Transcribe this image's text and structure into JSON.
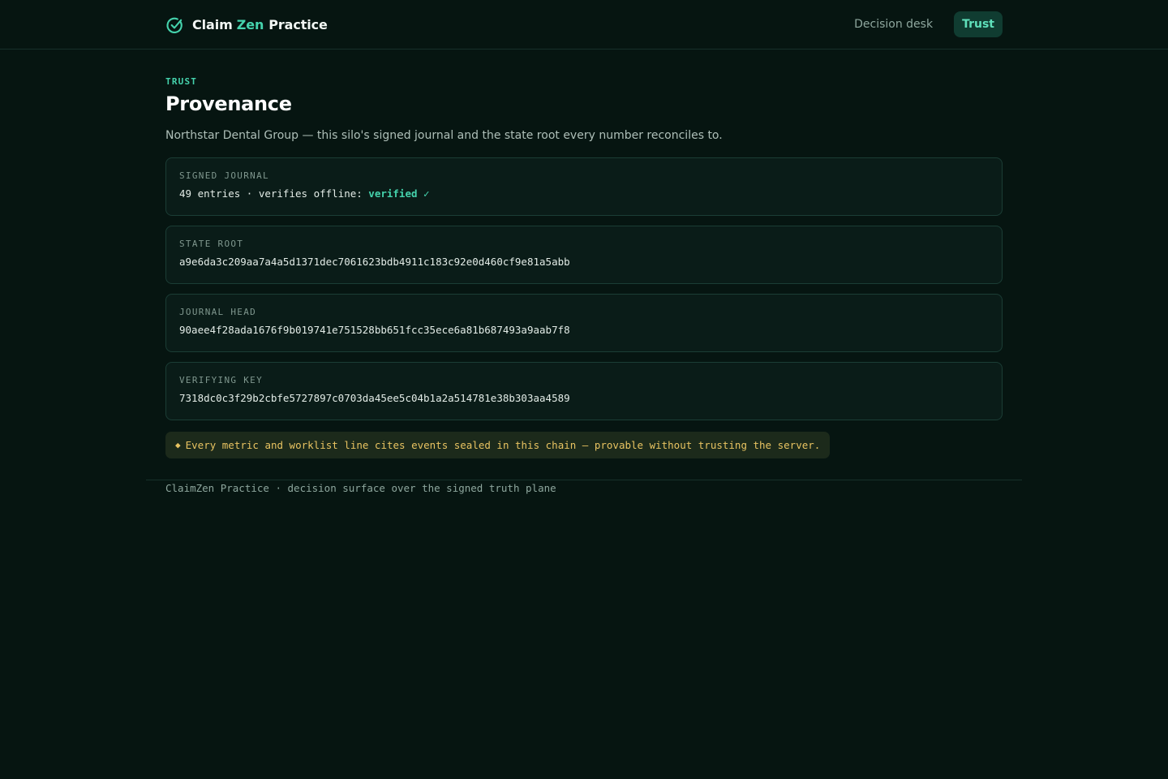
{
  "header": {
    "brand": {
      "part1": "Claim",
      "part2": "Zen",
      "part3": "Practice",
      "icon": "check-circle-icon"
    },
    "nav": [
      {
        "label": "Decision desk",
        "active": false
      },
      {
        "label": "Trust",
        "active": true
      }
    ]
  },
  "page": {
    "eyebrow": "TRUST",
    "title": "Provenance",
    "subtitle": "Northstar Dental Group — this silo's signed journal and the state root every number reconciles to."
  },
  "cards": {
    "signed_journal": {
      "label": "SIGNED JOURNAL",
      "value_prefix": "49 entries · verifies offline: ",
      "status": "verified ✓"
    },
    "state_root": {
      "label": "STATE ROOT",
      "value": "a9e6da3c209aa7a4a5d1371dec7061623bdb4911c183c92e0d460cf9e81a5abb"
    },
    "journal_head": {
      "label": "JOURNAL HEAD",
      "value": "90aee4f28ada1676f9b019741e751528bb651fcc35ece6a81b687493a9aab7f8"
    },
    "verifying_key": {
      "label": "VERIFYING KEY",
      "value": "7318dc0c3f29b2cbfe5727897c0703da45ee5c04b1a2a514781e38b303aa4589"
    }
  },
  "notice": {
    "icon": "◆",
    "text": "Every metric and worklist line cites events sealed in this chain — provable without trusting the server."
  },
  "footer": {
    "text": "ClaimZen Practice · decision surface over the signed truth plane"
  },
  "colors": {
    "background": "#061511",
    "accent": "#45d3ad",
    "notice": "#e8c361",
    "card": "#0a1c18"
  }
}
